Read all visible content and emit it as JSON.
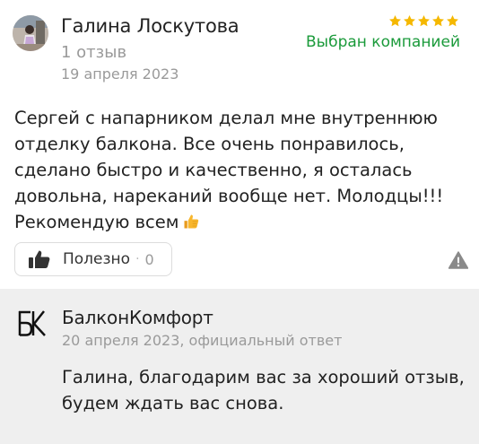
{
  "review": {
    "author_name": "Галина Лоскутова",
    "review_count": "1 отзыв",
    "date": "19 апреля 2023",
    "rating": 5,
    "star_color": "#f5b800",
    "company_choice_label": "Выбран компанией",
    "company_choice_color": "#1a9a3a",
    "text": "Сергей с напарником делал мне внутреннюю отделку балкона. Все очень понравилось, сделано быстро и качественно, я осталась довольна, нареканий вообще нет. Молодцы!!! Рекомендую всем",
    "text_emoji": "thumbs-up",
    "useful_label": "Полезно",
    "useful_separator": "·",
    "useful_count": "0"
  },
  "reply": {
    "company_name": "БалконКомфорт",
    "meta": "20 апреля 2023, официальный ответ",
    "text": "Галина, благодарим вас за хороший отзыв, будем ждать вас снова.",
    "background": "#efefef"
  }
}
